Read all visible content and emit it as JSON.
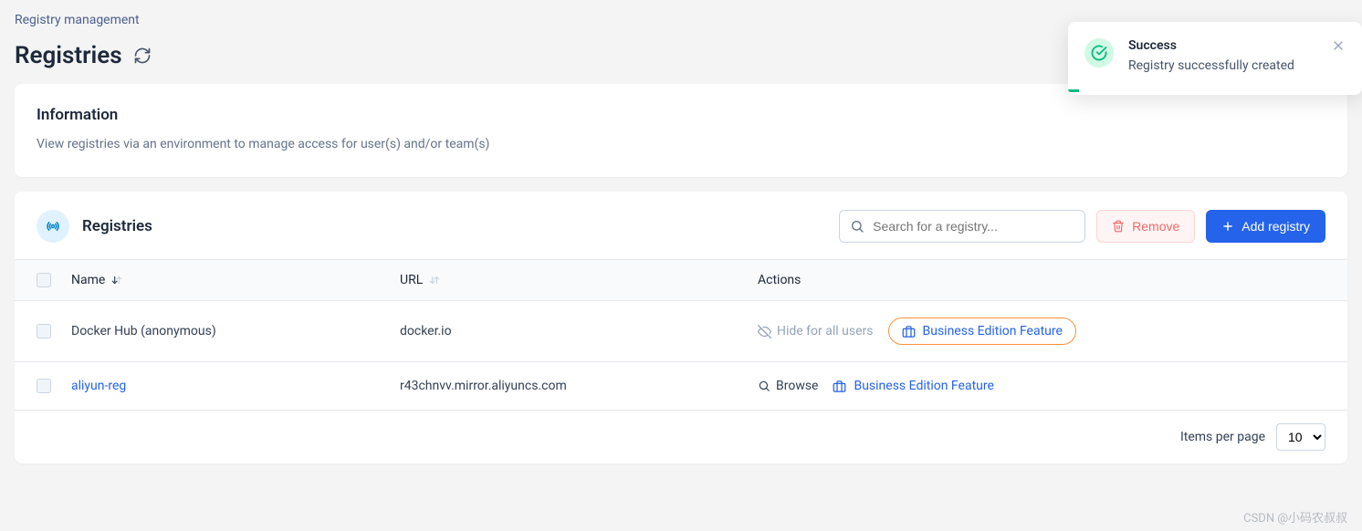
{
  "breadcrumb": "Registry management",
  "page_title": "Registries",
  "info": {
    "title": "Information",
    "desc": "View registries via an environment to manage access for user(s) and/or team(s)"
  },
  "registries": {
    "title": "Registries",
    "search_placeholder": "Search for a registry...",
    "remove_label": "Remove",
    "add_label": "Add registry",
    "columns": {
      "name": "Name",
      "url": "URL",
      "actions": "Actions"
    },
    "rows": [
      {
        "name": "Docker Hub (anonymous)",
        "url": "docker.io",
        "is_link": false,
        "hide_label": "Hide for all users",
        "bef_label": "Business Edition Feature",
        "browsable": false
      },
      {
        "name": "aliyun-reg",
        "url": "r43chnvv.mirror.aliyuncs.com",
        "is_link": true,
        "browse_label": "Browse",
        "bef_label": "Business Edition Feature",
        "browsable": true
      }
    ],
    "footer": {
      "items_per_page_label": "Items per page",
      "items_per_page_value": "10"
    }
  },
  "toast": {
    "title": "Success",
    "message": "Registry successfully created"
  },
  "watermark": "CSDN @小码农叔叔"
}
